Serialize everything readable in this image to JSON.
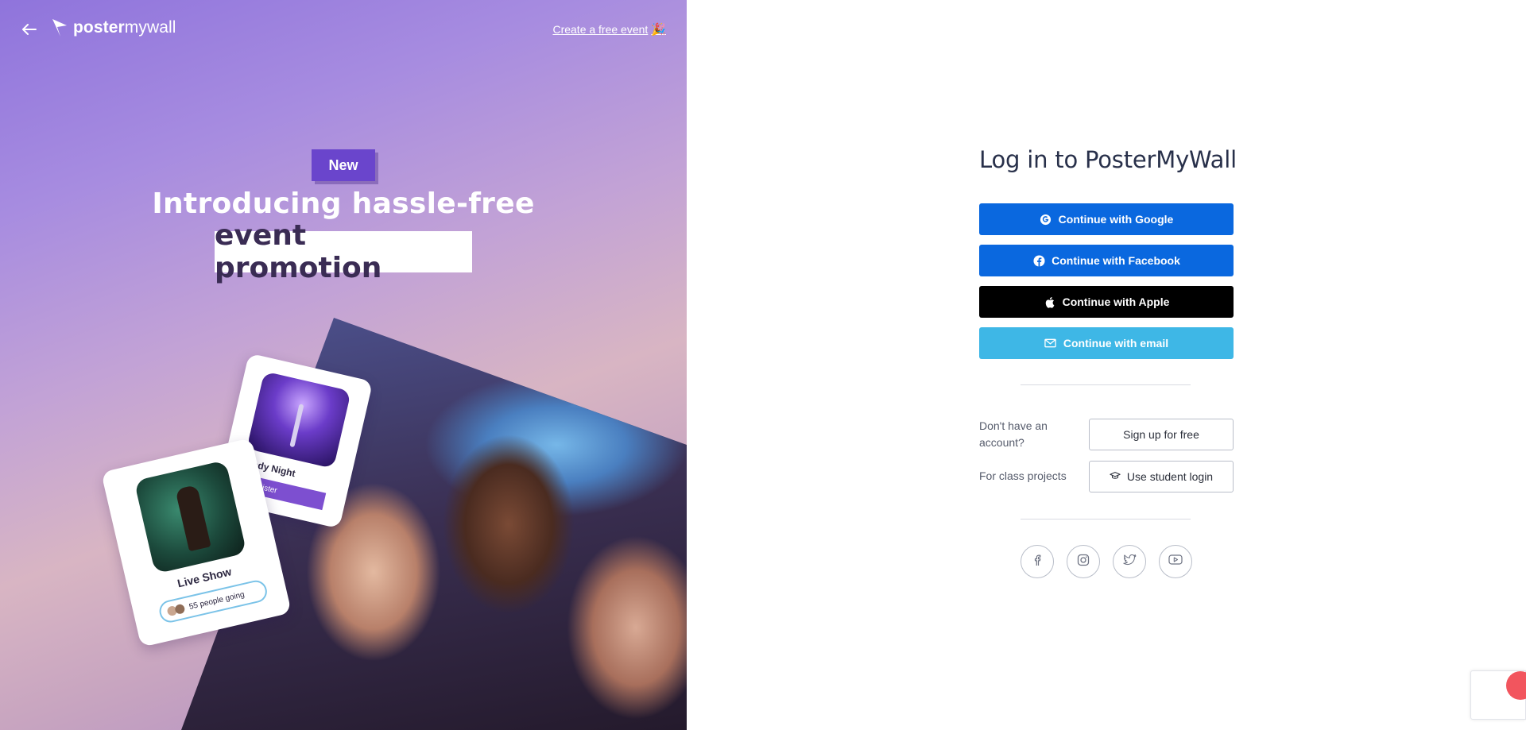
{
  "header": {
    "back_label": "Back",
    "logo_bold": "poster",
    "logo_light": "mywall",
    "create_event_link": "Create a free event",
    "create_event_emoji": "🎉"
  },
  "promo": {
    "badge": "New",
    "headline_line1": "Introducing hassle-free",
    "headline_line2": "event promotion",
    "card_comedy_title": "omedy Night",
    "card_comedy_button": "Register",
    "card_live_title": "Live Show",
    "card_live_going": "55 people going"
  },
  "login": {
    "title": "Log in to PosterMyWall",
    "buttons": {
      "google": "Continue with Google",
      "facebook": "Continue with Facebook",
      "apple": "Continue with Apple",
      "email": "Continue with email"
    },
    "signup_prompt": "Don't have an account?",
    "signup_button": "Sign up for free",
    "class_prompt": "For class projects",
    "student_button": "Use student login"
  },
  "social_icons": [
    "facebook-icon",
    "instagram-icon",
    "twitter-icon",
    "youtube-icon"
  ],
  "colors": {
    "primary_blue": "#0a68df",
    "apple_black": "#000000",
    "email_cyan": "#3eb7e6",
    "badge_purple": "#6a45cc"
  }
}
